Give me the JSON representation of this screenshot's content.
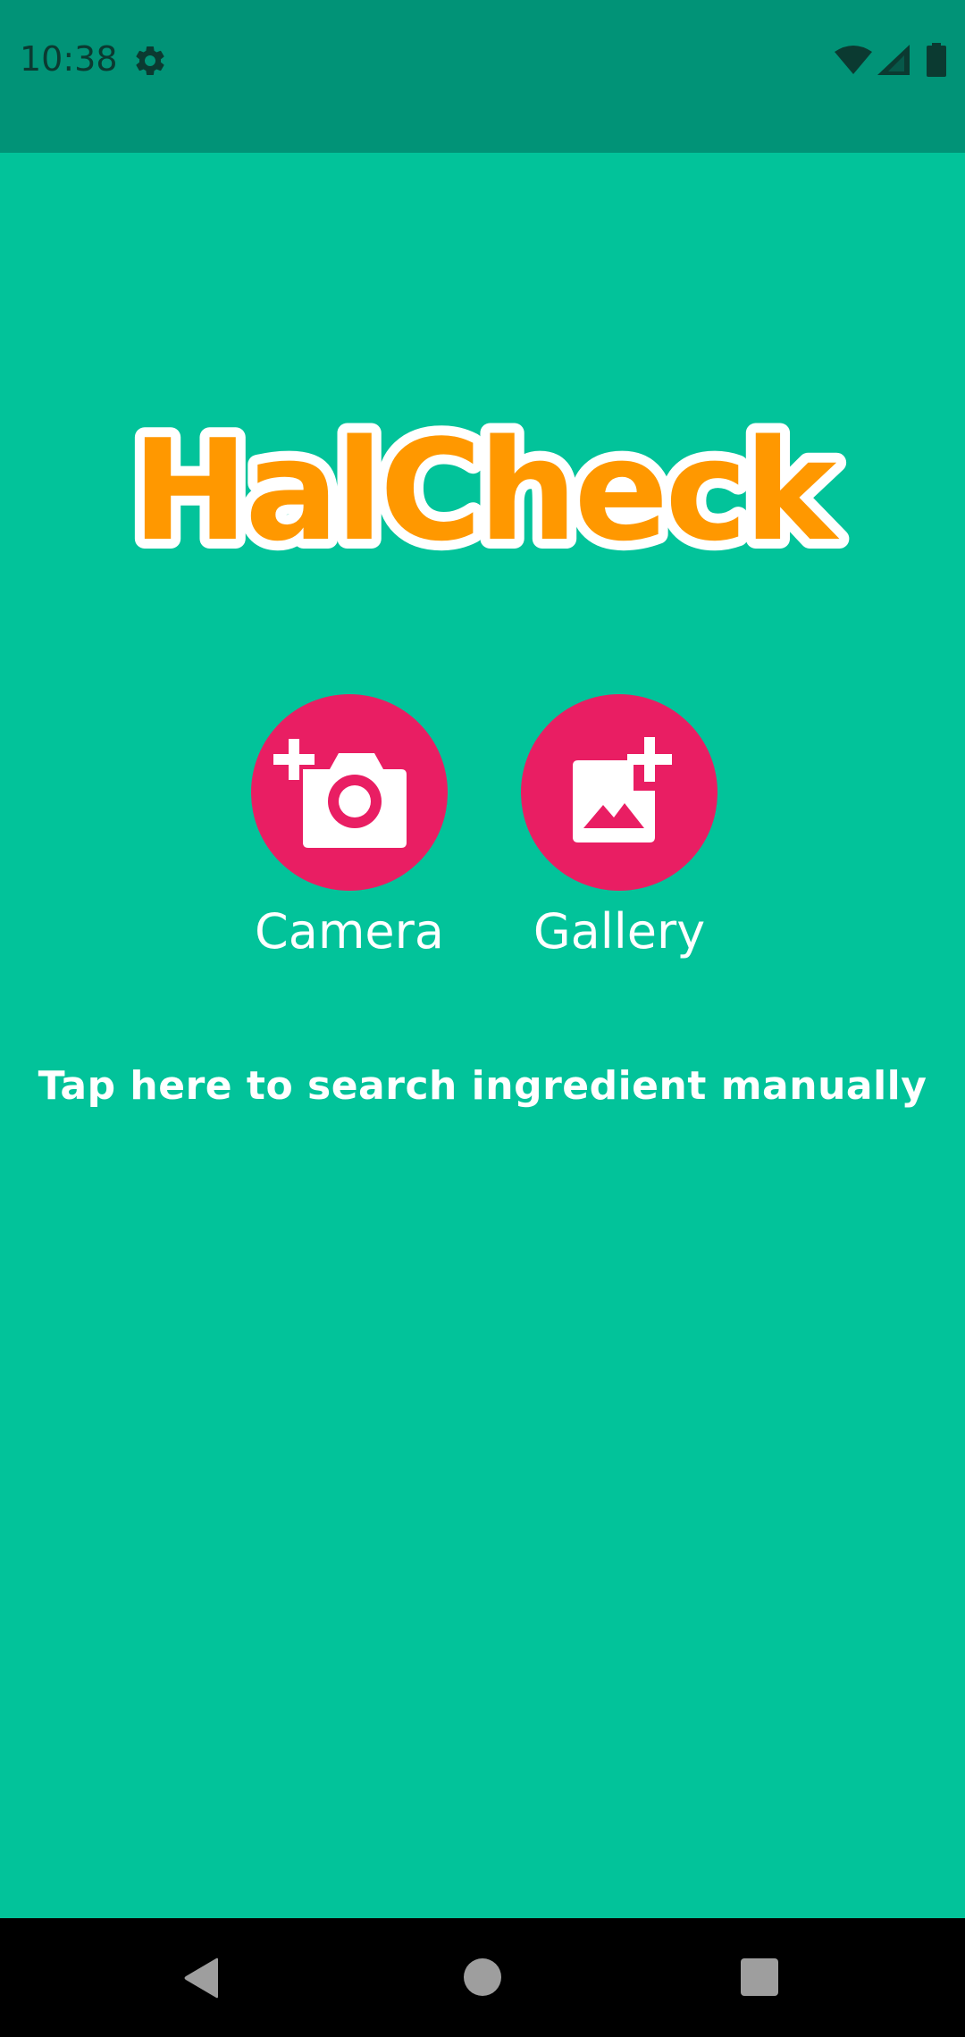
{
  "status_bar": {
    "time": "10:38",
    "icons": [
      "gear-icon",
      "wifi-icon",
      "signal-icon",
      "battery-icon"
    ]
  },
  "app": {
    "logo_text": "HalCheck",
    "colors": {
      "background": "#02C39A",
      "status_bar": "#019377",
      "accent": "#E91E63",
      "logo": "#FF9800"
    }
  },
  "actions": {
    "camera_label": "Camera",
    "camera_icon": "add-camera-icon",
    "gallery_label": "Gallery",
    "gallery_icon": "add-photo-icon"
  },
  "manual_search_text": "Tap here to search ingredient manually",
  "nav_bar": {
    "buttons": [
      "back-icon",
      "home-icon",
      "recent-apps-icon"
    ]
  }
}
